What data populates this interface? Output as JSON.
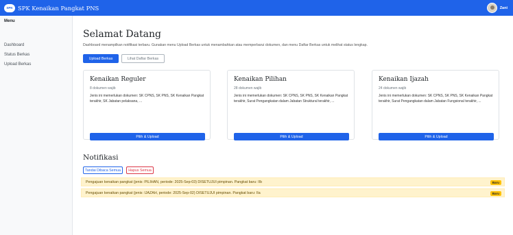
{
  "navbar": {
    "logo_text": "SPK",
    "brand": "SPK Kenaikan Pangkat PNS",
    "user_name": "Zani"
  },
  "sidebar": {
    "title": "Menu",
    "items": [
      {
        "label": "Dashboard"
      },
      {
        "label": "Status Berkas"
      },
      {
        "label": "Upload Berkas"
      }
    ]
  },
  "main": {
    "title": "Selamat Datang",
    "description": "Dashboard menampilkan notifikasi terbaru. Gunakan menu Upload Berkas untuk menambahkan atau memperbarui dokumen, dan menu Daftar Berkas untuk melihat status lengkap.",
    "tab_upload": "Upload Berkas",
    "tab_list": "Lihat Daftar Berkas",
    "cards": [
      {
        "title": "Kenaikan Reguler",
        "subtitle": "8 dokumen wajib",
        "text": "Jenis ini memerlukan dokumen: SK CPNS, SK PNS, SK Kenaikan Pangkat terakhir, SK Jabatan pelaksana, ...",
        "button": "Pilih & Upload"
      },
      {
        "title": "Kenaikan Pilihan",
        "subtitle": "28 dokumen wajib",
        "text": "Jenis ini memerlukan dokumen: SK CPNS, SK PNS, SK Kenaikan Pangkat terakhir, Surat Pengangkatan dalam Jabatan Struktural terakhir, ...",
        "button": "Pilih & Upload"
      },
      {
        "title": "Kenaikan Ijazah",
        "subtitle": "24 dokumen wajib",
        "text": "Jenis ini memerlukan dokumen: SK CPNS, SK PNS, SK Kenaikan Pangkat terakhir, Surat Pengangkatan dalam Jabatan Fungsional terakhir, ...",
        "button": "Pilih & Upload"
      }
    ]
  },
  "notifications": {
    "title": "Notifikasi",
    "mark_all_read": "Tandai Dibaca Semua",
    "delete_all": "Hapus Semua",
    "items": [
      {
        "text": "Pengajuan kenaikan pangkat (jenis: PILIHAN, periode: 2025-Sep-03) DISETUJUI pimpinan. Pangkat baru: IIb",
        "badge": "Baru"
      },
      {
        "text": "Pengajuan kenaikan pangkat (jenis: IJAZAH, periode: 2025-Sep-02) DISETUJUI pimpinan. Pangkat baru: IIa",
        "badge": "Baru"
      }
    ]
  },
  "colors": {
    "primary": "#1f63e9",
    "alert_bg": "#fff3cd",
    "badge": "#ffc107",
    "danger": "#dc3545"
  }
}
